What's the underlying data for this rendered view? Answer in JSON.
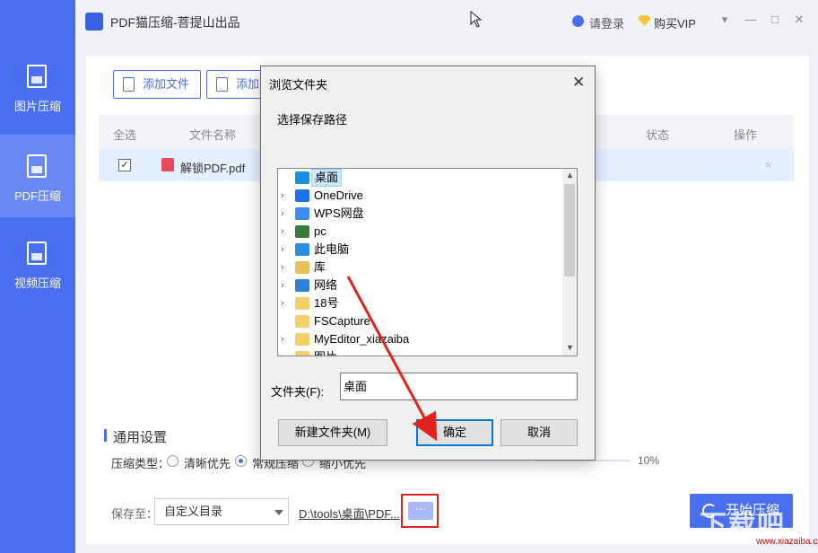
{
  "app": {
    "title": "PDF猫压缩-菩提山出品",
    "login_label": "请登录",
    "vip_label": "购买VIP",
    "window_controls": [
      "▾",
      "—",
      "□",
      "✕"
    ]
  },
  "sidebar": {
    "items": [
      {
        "label": "图片压缩",
        "icon": "image-file-icon"
      },
      {
        "label": "PDF压缩",
        "icon": "pdf-file-icon"
      },
      {
        "label": "视频压缩",
        "icon": "video-file-icon"
      }
    ],
    "active_index": 1
  },
  "toolbar": {
    "add_file_label": "添加文件",
    "add_folder_label": "添加文"
  },
  "table": {
    "headers": [
      "全选",
      "文件名称",
      "状态",
      "操作"
    ],
    "rows": [
      {
        "checked": true,
        "file_name": "解锁PDF.pdf",
        "remove_label": "×"
      }
    ]
  },
  "settings": {
    "title": "通用设置",
    "type_label": "压缩类型：",
    "options": [
      "清晰优先",
      "常规压缩",
      "缩小优先"
    ],
    "selected_option": 1,
    "slider_value": "10%"
  },
  "footer": {
    "save_label": "保存至：",
    "directory_option": "自定义目录",
    "path_text": "D:\\tools\\桌面\\PDF...",
    "more_label": "···",
    "start_label": "开始压缩"
  },
  "dialog": {
    "title": "浏览文件夹",
    "close_label": "✕",
    "subtitle": "选择保存路径",
    "tree": [
      {
        "label": "桌面",
        "icon": "desktop-icon",
        "color": "#1a8fe0",
        "expandable": false,
        "selected": true
      },
      {
        "label": "OneDrive",
        "icon": "cloud-icon",
        "color": "#1a73e8",
        "expandable": true
      },
      {
        "label": "WPS网盘",
        "icon": "cloud-icon",
        "color": "#3f8cf0",
        "expandable": true
      },
      {
        "label": "pc",
        "icon": "user-icon",
        "color": "#3a7a3a",
        "expandable": true
      },
      {
        "label": "此电脑",
        "icon": "computer-icon",
        "color": "#2b8ee0",
        "expandable": true
      },
      {
        "label": "库",
        "icon": "library-icon",
        "color": "#e8c15a",
        "expandable": true
      },
      {
        "label": "网络",
        "icon": "network-icon",
        "color": "#2f7fd8",
        "expandable": true
      },
      {
        "label": "18号",
        "icon": "folder-icon",
        "color": "#f3cf6a",
        "expandable": true
      },
      {
        "label": "FSCapture",
        "icon": "folder-icon",
        "color": "#f3cf6a",
        "expandable": false
      },
      {
        "label": "MyEditor_xiazaiba",
        "icon": "folder-icon",
        "color": "#f3cf6a",
        "expandable": true
      },
      {
        "label": "图片",
        "icon": "folder-icon",
        "color": "#f3cf6a",
        "expandable": true
      }
    ],
    "folder_label": "文件夹(F):",
    "folder_value": "桌面",
    "new_folder_label": "新建文件夹(M)",
    "ok_label": "确定",
    "cancel_label": "取消"
  },
  "watermark": {
    "text": "下载吧",
    "sub": "www.xiazaiba.com"
  },
  "colors": {
    "accent": "#4a6ef0",
    "annotation": "#e0231c"
  }
}
